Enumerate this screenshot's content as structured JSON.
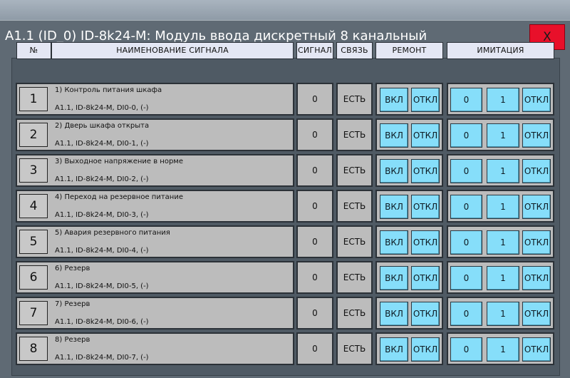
{
  "window": {
    "title": "A1.1 (ID_0) ID-8k24-M: Модуль ввода дискретный 8 канальный",
    "close_label": "X"
  },
  "headers": {
    "num": "№",
    "name": "НАИМЕНОВАНИЕ СИГНАЛА",
    "signal": "СИГНАЛ",
    "link": "СВЯЗЬ",
    "repair": "РЕМОНТ",
    "imitation": "ИМИТАЦИЯ"
  },
  "rows": [
    {
      "num": "1",
      "name": "1) Контроль питания шкафа",
      "addr": "A1.1, ID-8k24-M, DI0-0,  (-)",
      "signal": "0",
      "link": "ЕСТЬ",
      "repair_on": "ВКЛ",
      "repair_off": "ОТКЛ",
      "imit_0": "0",
      "imit_1": "1",
      "imit_off": "ОТКЛ"
    },
    {
      "num": "2",
      "name": "2) Дверь шкафа открыта",
      "addr": "A1.1, ID-8k24-M, DI0-1,  (-)",
      "signal": "0",
      "link": "ЕСТЬ",
      "repair_on": "ВКЛ",
      "repair_off": "ОТКЛ",
      "imit_0": "0",
      "imit_1": "1",
      "imit_off": "ОТКЛ"
    },
    {
      "num": "3",
      "name": "3) Выходное напряжение в норме",
      "addr": "A1.1, ID-8k24-M, DI0-2,  (-)",
      "signal": "0",
      "link": "ЕСТЬ",
      "repair_on": "ВКЛ",
      "repair_off": "ОТКЛ",
      "imit_0": "0",
      "imit_1": "1",
      "imit_off": "ОТКЛ"
    },
    {
      "num": "4",
      "name": "4) Переход на резервное питание",
      "addr": "A1.1, ID-8k24-M, DI0-3,  (-)",
      "signal": "0",
      "link": "ЕСТЬ",
      "repair_on": "ВКЛ",
      "repair_off": "ОТКЛ",
      "imit_0": "0",
      "imit_1": "1",
      "imit_off": "ОТКЛ"
    },
    {
      "num": "5",
      "name": "5) Авария резервного питания",
      "addr": "A1.1, ID-8k24-M, DI0-4,  (-)",
      "signal": "0",
      "link": "ЕСТЬ",
      "repair_on": "ВКЛ",
      "repair_off": "ОТКЛ",
      "imit_0": "0",
      "imit_1": "1",
      "imit_off": "ОТКЛ"
    },
    {
      "num": "6",
      "name": "6) Резерв",
      "addr": "A1.1, ID-8k24-M, DI0-5,  (-)",
      "signal": "0",
      "link": "ЕСТЬ",
      "repair_on": "ВКЛ",
      "repair_off": "ОТКЛ",
      "imit_0": "0",
      "imit_1": "1",
      "imit_off": "ОТКЛ"
    },
    {
      "num": "7",
      "name": "7) Резерв",
      "addr": "A1.1, ID-8k24-M, DI0-6,  (-)",
      "signal": "0",
      "link": "ЕСТЬ",
      "repair_on": "ВКЛ",
      "repair_off": "ОТКЛ",
      "imit_0": "0",
      "imit_1": "1",
      "imit_off": "ОТКЛ"
    },
    {
      "num": "8",
      "name": "8) Резерв",
      "addr": "A1.1, ID-8k24-M, DI0-7,  (-)",
      "signal": "0",
      "link": "ЕСТЬ",
      "repair_on": "ВКЛ",
      "repair_off": "ОТКЛ",
      "imit_0": "0",
      "imit_1": "1",
      "imit_off": "ОТКЛ"
    }
  ]
}
